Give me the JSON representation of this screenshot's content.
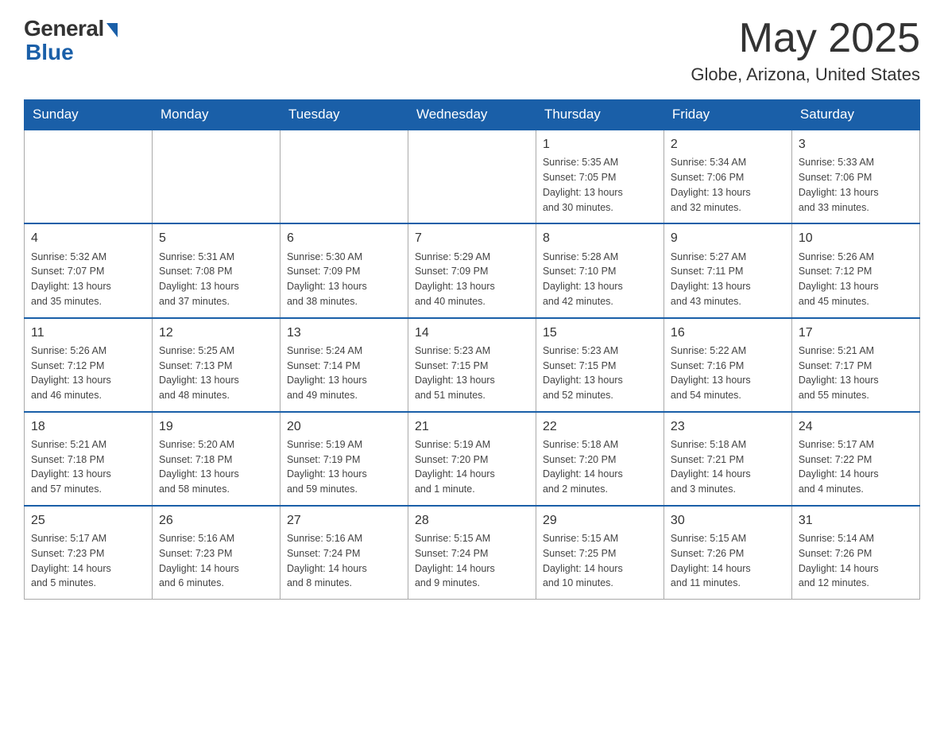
{
  "header": {
    "logo_general": "General",
    "logo_blue": "Blue",
    "month_year": "May 2025",
    "location": "Globe, Arizona, United States"
  },
  "days_of_week": [
    "Sunday",
    "Monday",
    "Tuesday",
    "Wednesday",
    "Thursday",
    "Friday",
    "Saturday"
  ],
  "weeks": [
    [
      {
        "day": "",
        "info": ""
      },
      {
        "day": "",
        "info": ""
      },
      {
        "day": "",
        "info": ""
      },
      {
        "day": "",
        "info": ""
      },
      {
        "day": "1",
        "info": "Sunrise: 5:35 AM\nSunset: 7:05 PM\nDaylight: 13 hours\nand 30 minutes."
      },
      {
        "day": "2",
        "info": "Sunrise: 5:34 AM\nSunset: 7:06 PM\nDaylight: 13 hours\nand 32 minutes."
      },
      {
        "day": "3",
        "info": "Sunrise: 5:33 AM\nSunset: 7:06 PM\nDaylight: 13 hours\nand 33 minutes."
      }
    ],
    [
      {
        "day": "4",
        "info": "Sunrise: 5:32 AM\nSunset: 7:07 PM\nDaylight: 13 hours\nand 35 minutes."
      },
      {
        "day": "5",
        "info": "Sunrise: 5:31 AM\nSunset: 7:08 PM\nDaylight: 13 hours\nand 37 minutes."
      },
      {
        "day": "6",
        "info": "Sunrise: 5:30 AM\nSunset: 7:09 PM\nDaylight: 13 hours\nand 38 minutes."
      },
      {
        "day": "7",
        "info": "Sunrise: 5:29 AM\nSunset: 7:09 PM\nDaylight: 13 hours\nand 40 minutes."
      },
      {
        "day": "8",
        "info": "Sunrise: 5:28 AM\nSunset: 7:10 PM\nDaylight: 13 hours\nand 42 minutes."
      },
      {
        "day": "9",
        "info": "Sunrise: 5:27 AM\nSunset: 7:11 PM\nDaylight: 13 hours\nand 43 minutes."
      },
      {
        "day": "10",
        "info": "Sunrise: 5:26 AM\nSunset: 7:12 PM\nDaylight: 13 hours\nand 45 minutes."
      }
    ],
    [
      {
        "day": "11",
        "info": "Sunrise: 5:26 AM\nSunset: 7:12 PM\nDaylight: 13 hours\nand 46 minutes."
      },
      {
        "day": "12",
        "info": "Sunrise: 5:25 AM\nSunset: 7:13 PM\nDaylight: 13 hours\nand 48 minutes."
      },
      {
        "day": "13",
        "info": "Sunrise: 5:24 AM\nSunset: 7:14 PM\nDaylight: 13 hours\nand 49 minutes."
      },
      {
        "day": "14",
        "info": "Sunrise: 5:23 AM\nSunset: 7:15 PM\nDaylight: 13 hours\nand 51 minutes."
      },
      {
        "day": "15",
        "info": "Sunrise: 5:23 AM\nSunset: 7:15 PM\nDaylight: 13 hours\nand 52 minutes."
      },
      {
        "day": "16",
        "info": "Sunrise: 5:22 AM\nSunset: 7:16 PM\nDaylight: 13 hours\nand 54 minutes."
      },
      {
        "day": "17",
        "info": "Sunrise: 5:21 AM\nSunset: 7:17 PM\nDaylight: 13 hours\nand 55 minutes."
      }
    ],
    [
      {
        "day": "18",
        "info": "Sunrise: 5:21 AM\nSunset: 7:18 PM\nDaylight: 13 hours\nand 57 minutes."
      },
      {
        "day": "19",
        "info": "Sunrise: 5:20 AM\nSunset: 7:18 PM\nDaylight: 13 hours\nand 58 minutes."
      },
      {
        "day": "20",
        "info": "Sunrise: 5:19 AM\nSunset: 7:19 PM\nDaylight: 13 hours\nand 59 minutes."
      },
      {
        "day": "21",
        "info": "Sunrise: 5:19 AM\nSunset: 7:20 PM\nDaylight: 14 hours\nand 1 minute."
      },
      {
        "day": "22",
        "info": "Sunrise: 5:18 AM\nSunset: 7:20 PM\nDaylight: 14 hours\nand 2 minutes."
      },
      {
        "day": "23",
        "info": "Sunrise: 5:18 AM\nSunset: 7:21 PM\nDaylight: 14 hours\nand 3 minutes."
      },
      {
        "day": "24",
        "info": "Sunrise: 5:17 AM\nSunset: 7:22 PM\nDaylight: 14 hours\nand 4 minutes."
      }
    ],
    [
      {
        "day": "25",
        "info": "Sunrise: 5:17 AM\nSunset: 7:23 PM\nDaylight: 14 hours\nand 5 minutes."
      },
      {
        "day": "26",
        "info": "Sunrise: 5:16 AM\nSunset: 7:23 PM\nDaylight: 14 hours\nand 6 minutes."
      },
      {
        "day": "27",
        "info": "Sunrise: 5:16 AM\nSunset: 7:24 PM\nDaylight: 14 hours\nand 8 minutes."
      },
      {
        "day": "28",
        "info": "Sunrise: 5:15 AM\nSunset: 7:24 PM\nDaylight: 14 hours\nand 9 minutes."
      },
      {
        "day": "29",
        "info": "Sunrise: 5:15 AM\nSunset: 7:25 PM\nDaylight: 14 hours\nand 10 minutes."
      },
      {
        "day": "30",
        "info": "Sunrise: 5:15 AM\nSunset: 7:26 PM\nDaylight: 14 hours\nand 11 minutes."
      },
      {
        "day": "31",
        "info": "Sunrise: 5:14 AM\nSunset: 7:26 PM\nDaylight: 14 hours\nand 12 minutes."
      }
    ]
  ]
}
